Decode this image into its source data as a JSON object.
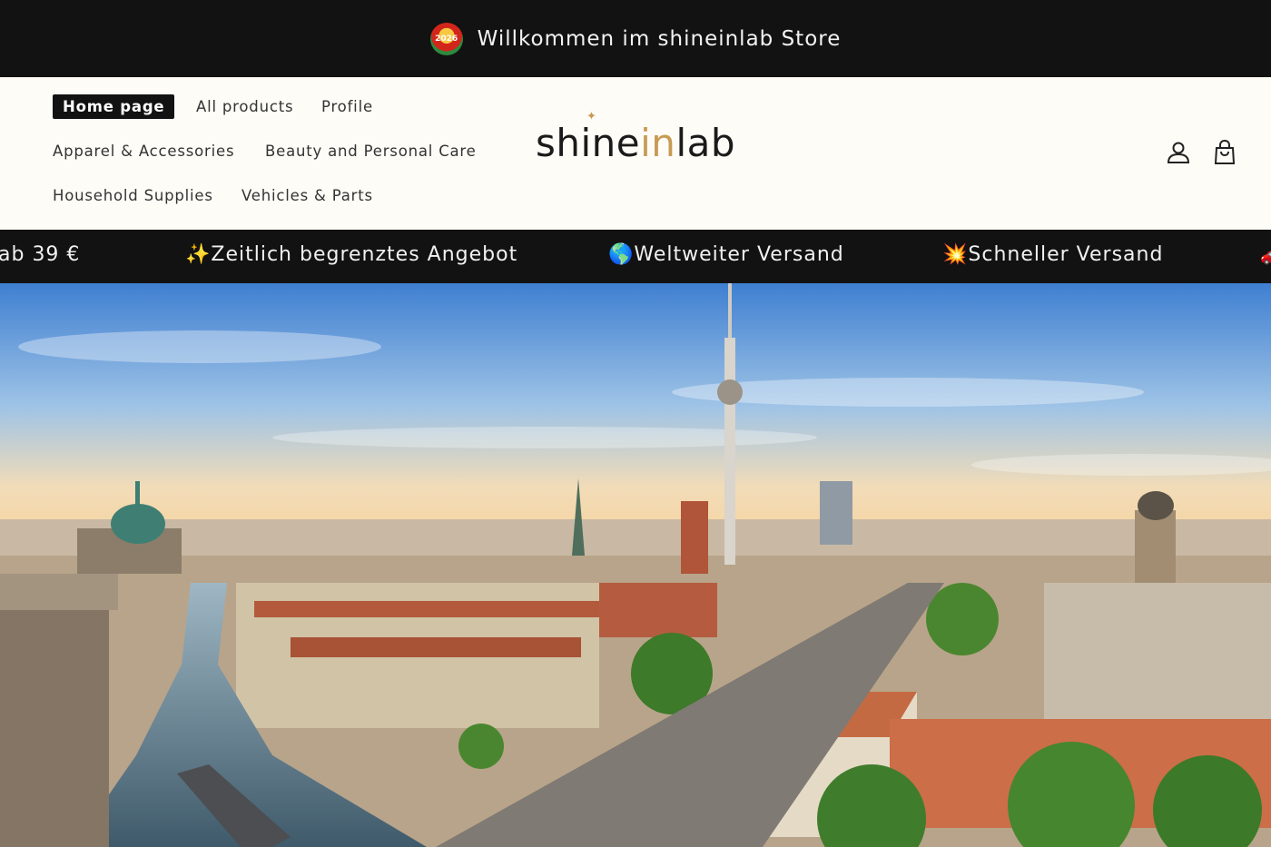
{
  "announcement": {
    "badge_text": "2026",
    "text": "Willkommen im shineinlab Store"
  },
  "nav": {
    "home": "Home page",
    "all_products": "All products",
    "profile": "Profile",
    "apparel": "Apparel & Accessories",
    "beauty": "Beauty and Personal Care",
    "household": "Household Supplies",
    "vehicles": "Vehicles & Parts"
  },
  "logo": {
    "part1": "shine",
    "part2": "in",
    "part3": "lab"
  },
  "icons": {
    "account": "account-icon",
    "cart": "shopping-bag-icon"
  },
  "marquee": {
    "item1": "ab 39 €",
    "item2": "✨Zeitlich begrenztes Angebot",
    "item3": "🌎Weltweiter Versand",
    "item4": "💥Schneller Versand",
    "item5": "🚗"
  },
  "colors": {
    "bar_background": "#121212",
    "header_background": "#fdfcf6",
    "logo_accent": "#c89b54"
  }
}
